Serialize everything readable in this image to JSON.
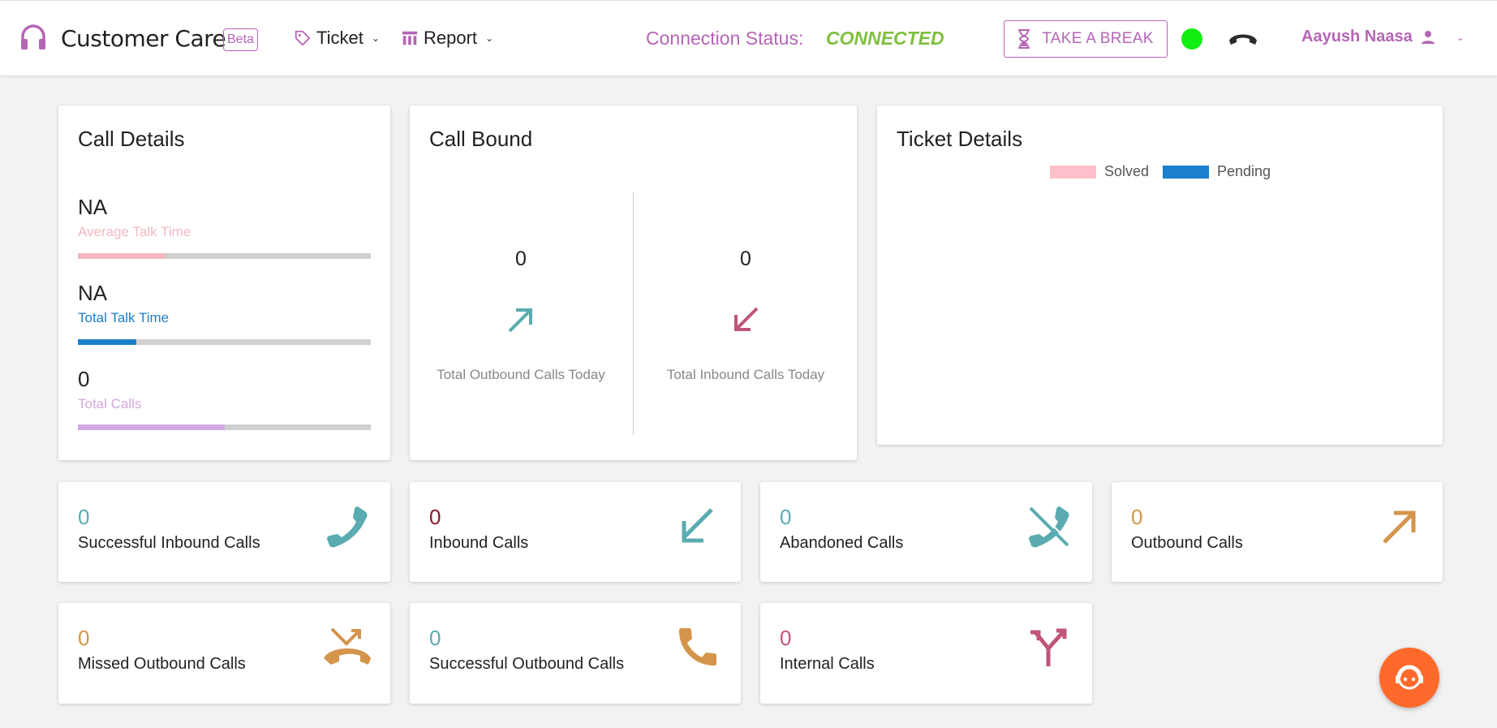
{
  "header": {
    "app_title": "Customer Care",
    "beta": "Beta",
    "nav": [
      {
        "label": "Ticket",
        "icon": "tag-icon"
      },
      {
        "label": "Report",
        "icon": "report-icon"
      }
    ],
    "connection_label": "Connection Status:",
    "connection_value": "CONNECTED",
    "take_break": "TAKE A BREAK",
    "user_name": "Aayush Naasa"
  },
  "call_details": {
    "title": "Call Details",
    "metrics": [
      {
        "value": "NA",
        "label": "Average Talk Time",
        "color": "#f4b8c1",
        "progress": 0.3
      },
      {
        "value": "NA",
        "label": "Total Talk Time",
        "color": "#1c7fc9",
        "progress": 0.2
      },
      {
        "value": "0",
        "label": "Total Calls",
        "color": "#d2a8e0",
        "progress": 0.5
      }
    ]
  },
  "call_bound": {
    "title": "Call Bound",
    "outbound": {
      "value": "0",
      "label": "Total Outbound Calls Today",
      "icon": "arrow-up-right-icon"
    },
    "inbound": {
      "value": "0",
      "label": "Total Inbound Calls Today",
      "icon": "arrow-down-left-icon"
    }
  },
  "ticket_details": {
    "title": "Ticket Details",
    "legend": [
      {
        "label": "Solved",
        "color": "#ffc0cb"
      },
      {
        "label": "Pending",
        "color": "#1a7fcd"
      }
    ]
  },
  "stats": [
    {
      "value": "0",
      "label": "Successful Inbound Calls",
      "color": "#5aacb0",
      "icon": "phone-icon"
    },
    {
      "value": "0",
      "label": "Inbound Calls",
      "color": "#8b1a2b",
      "icon": "arrow-down-left-icon"
    },
    {
      "value": "0",
      "label": "Abandoned Calls",
      "color": "#5aacb0",
      "icon": "phone-off-icon"
    },
    {
      "value": "0",
      "label": "Outbound Calls",
      "color": "#d4944a",
      "icon": "arrow-up-right-icon"
    },
    {
      "value": "0",
      "label": "Missed Outbound Calls",
      "color": "#d4944a",
      "icon": "missed-call-icon"
    },
    {
      "value": "0",
      "label": "Successful Outbound Calls",
      "color": "#5aacb0",
      "icon": "phone-icon"
    },
    {
      "value": "0",
      "label": "Internal Calls",
      "color": "#c0547a",
      "icon": "call-split-icon"
    }
  ],
  "colors": {
    "brand": "#b565b5",
    "connected": "#7fbf3f",
    "status_online": "#11ee11",
    "fab": "#ff6a2b"
  }
}
